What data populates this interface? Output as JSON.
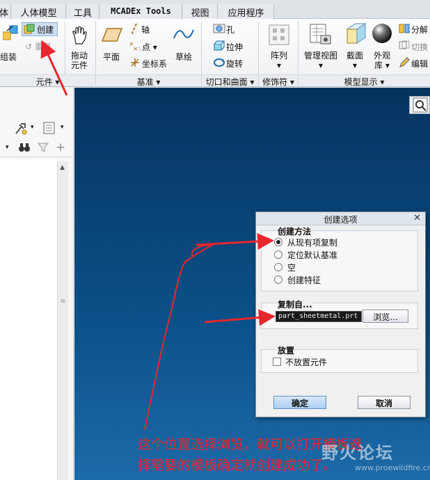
{
  "tabs": [
    "体",
    "人体模型",
    "工具",
    "MCADEx Tools",
    "视图",
    "应用程序"
  ],
  "ribbon": {
    "assemble": "组装",
    "create": "创建",
    "repeat": "重复",
    "drag_l1": "拖动",
    "drag_l2": "元件",
    "plane": "平面",
    "axis": "轴",
    "point": "点",
    "csys": "坐标系",
    "sketch": "草绘",
    "hole": "孔",
    "extrude": "拉伸",
    "revolve": "旋转",
    "pattern": "阵列",
    "manage_views": "管理视图",
    "section": "截面",
    "appearance_l1": "外观",
    "appearance_l2": "库",
    "explode": "分解",
    "toggle": "切换",
    "edit": "编辑",
    "groups": {
      "component": "元件",
      "datum": "基准",
      "cut_surface": "切口和曲面",
      "modifier": "修饰符",
      "model_display": "模型显示"
    }
  },
  "dialog": {
    "title": "创建选项",
    "method_legend": "创建方法",
    "options": [
      {
        "label": "从现有项复制",
        "selected": true
      },
      {
        "label": "定位默认基准",
        "selected": false
      },
      {
        "label": "空",
        "selected": false
      },
      {
        "label": "创建特征",
        "selected": false
      }
    ],
    "copy_legend": "复制自...",
    "copy_value": "part_sheetmetal.prt",
    "browse": "浏览...",
    "place_legend": "放置",
    "no_place": "不放置元件",
    "ok": "确定",
    "cancel": "取消"
  },
  "annotation": {
    "line1": "这个位置选择浏览，就可以打开模板选",
    "line2": "择需要的模板确定就创建成功了。",
    "color": "#e8262d"
  },
  "watermark": {
    "text": "野火论坛",
    "url": "www.proewildfire.cn"
  }
}
